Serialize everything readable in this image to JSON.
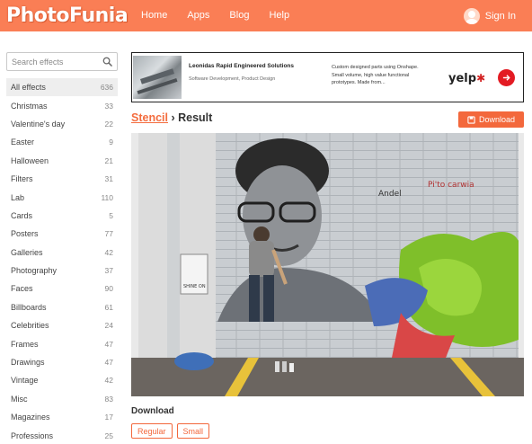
{
  "header": {
    "logo_photo": "Photo",
    "logo_funia": "Funia",
    "nav": [
      "Home",
      "Apps",
      "Blog",
      "Help"
    ],
    "signin": "Sign In"
  },
  "sidebar": {
    "search_placeholder": "Search effects",
    "items": [
      {
        "label": "All effects",
        "count": "636",
        "active": true
      },
      {
        "label": "Christmas",
        "count": "33"
      },
      {
        "label": "Valentine's day",
        "count": "22"
      },
      {
        "label": "Easter",
        "count": "9"
      },
      {
        "label": "Halloween",
        "count": "21"
      },
      {
        "label": "Filters",
        "count": "31"
      },
      {
        "label": "Lab",
        "count": "110"
      },
      {
        "label": "Cards",
        "count": "5"
      },
      {
        "label": "Posters",
        "count": "77"
      },
      {
        "label": "Galleries",
        "count": "42"
      },
      {
        "label": "Photography",
        "count": "37"
      },
      {
        "label": "Faces",
        "count": "90"
      },
      {
        "label": "Billboards",
        "count": "61"
      },
      {
        "label": "Celebrities",
        "count": "24"
      },
      {
        "label": "Frames",
        "count": "47"
      },
      {
        "label": "Drawings",
        "count": "47"
      },
      {
        "label": "Vintage",
        "count": "42"
      },
      {
        "label": "Misc",
        "count": "83"
      },
      {
        "label": "Magazines",
        "count": "17"
      },
      {
        "label": "Professions",
        "count": "25"
      }
    ]
  },
  "ad": {
    "title": "Leonidas Rapid Engineered Solutions",
    "subtitle": "Software Development, Product Design",
    "text": "Custom designed parts using Onshape. Small volume, high value functional prototypes. Made from...",
    "brand": "yelp"
  },
  "result": {
    "crumb_link": "Stencil",
    "crumb_sep": " › ",
    "crumb_current": "Result",
    "download_button": "Download",
    "download_heading": "Download",
    "sizes": [
      "Regular",
      "Small"
    ]
  },
  "colors": {
    "brand": "#fa7e55",
    "accent": "#f3683c"
  }
}
